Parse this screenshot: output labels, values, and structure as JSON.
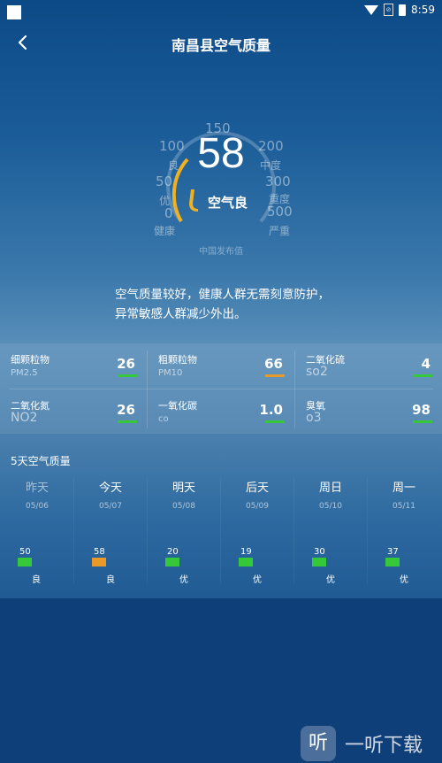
{
  "status": {
    "time": "8:59"
  },
  "header": {
    "title": "南昌县空气质量"
  },
  "gauge": {
    "value": "58",
    "level": "空气良",
    "source": "中国发布值",
    "ticks": [
      {
        "num": "150",
        "label": ""
      },
      {
        "num": "100",
        "label": "良"
      },
      {
        "num": "200",
        "label": "中度"
      },
      {
        "num": "50",
        "label": "优"
      },
      {
        "num": "300",
        "label": "重度"
      },
      {
        "num": "0",
        "label": "健康"
      },
      {
        "num": "500",
        "label": "严重"
      }
    ]
  },
  "advice": "空气质量较好，健康人群无需刻意防护，异常敏感人群减少外出。",
  "pollutants": [
    {
      "name": "细颗粒物",
      "code": "PM2.5",
      "value": "26",
      "color": "#35c93a"
    },
    {
      "name": "粗颗粒物",
      "code": "PM10",
      "value": "66",
      "color": "#e79a29"
    },
    {
      "name": "二氧化硫",
      "code": "so2",
      "value": "4",
      "color": "#35c93a"
    },
    {
      "name": "二氧化氮",
      "code": "NO2",
      "value": "26",
      "color": "#35c93a"
    },
    {
      "name": "一氧化碳",
      "code": "co",
      "value": "1.0",
      "color": "#35c93a"
    },
    {
      "name": "臭氧",
      "code": "o3",
      "value": "98",
      "color": "#35c93a"
    }
  ],
  "forecast": {
    "title": "5天空气质量",
    "days": [
      {
        "name": "昨天",
        "date": "05/06",
        "aqi": "50",
        "level": "良",
        "color": "#35c93a",
        "past": true
      },
      {
        "name": "今天",
        "date": "05/07",
        "aqi": "58",
        "level": "良",
        "color": "#e79a29",
        "past": false
      },
      {
        "name": "明天",
        "date": "05/08",
        "aqi": "20",
        "level": "优",
        "color": "#35c93a",
        "past": false
      },
      {
        "name": "后天",
        "date": "05/09",
        "aqi": "19",
        "level": "优",
        "color": "#35c93a",
        "past": false
      },
      {
        "name": "周日",
        "date": "05/10",
        "aqi": "30",
        "level": "优",
        "color": "#35c93a",
        "past": false
      },
      {
        "name": "周一",
        "date": "05/11",
        "aqi": "37",
        "level": "优",
        "color": "#35c93a",
        "past": false
      }
    ]
  },
  "watermark": {
    "icon": "听",
    "text": "一听下载"
  }
}
